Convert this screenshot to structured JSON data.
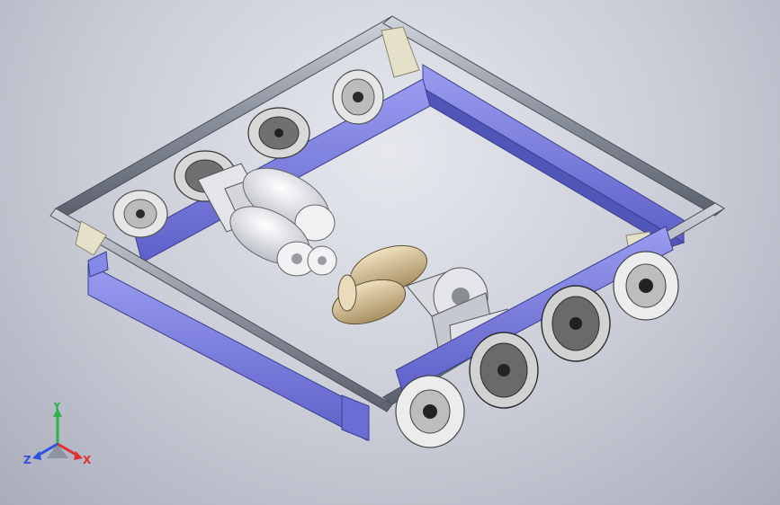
{
  "viewport": {
    "background_top": "#e6e8ee",
    "background_bottom": "#a9adbb"
  },
  "model": {
    "frame_color": "#7c7ee0",
    "rail_color": "#9aa0aa",
    "gusset_color": "#e5e0c8",
    "wheel_color": "#3a3a3a",
    "roller_color": "#f0f0f0",
    "motor_color": "#f4f4f6",
    "motor_can_color": "#d9c7a3"
  },
  "triad": {
    "x_label": "X",
    "y_label": "Y",
    "z_label": "Z",
    "x_color": "#e03030",
    "y_color": "#2fb34a",
    "z_color": "#3050e0"
  }
}
